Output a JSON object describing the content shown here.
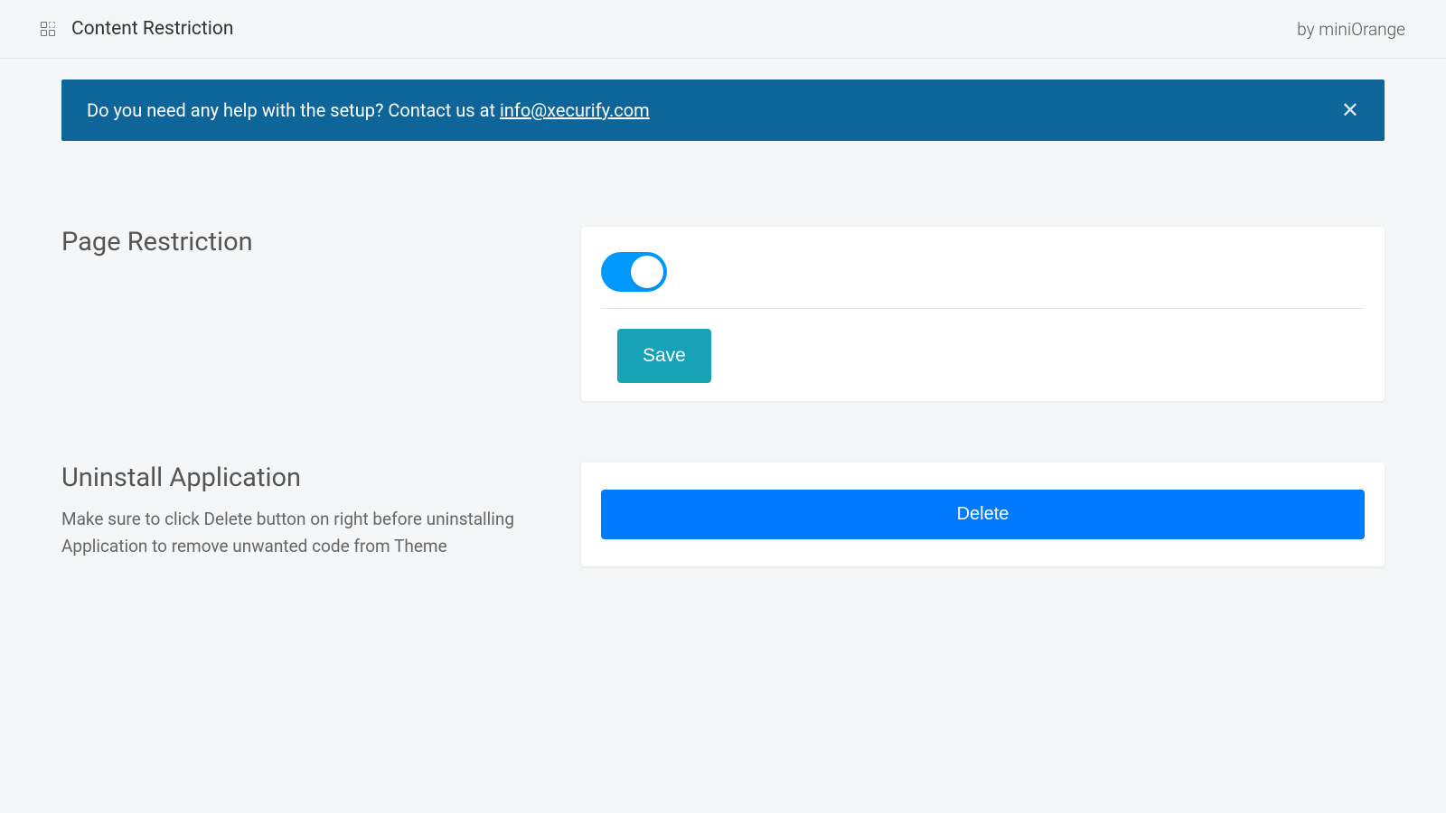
{
  "header": {
    "title": "Content Restriction",
    "by_text": "by miniOrange"
  },
  "banner": {
    "prefix": "Do you need any help with the setup? Contact us at ",
    "email": "info@xecurify.com"
  },
  "sections": {
    "page_restriction": {
      "title": "Page Restriction",
      "save_label": "Save"
    },
    "uninstall": {
      "title": "Uninstall Application",
      "description": "Make sure to click Delete button on right before uninstalling Application to remove unwanted code from Theme",
      "delete_label": "Delete"
    }
  }
}
